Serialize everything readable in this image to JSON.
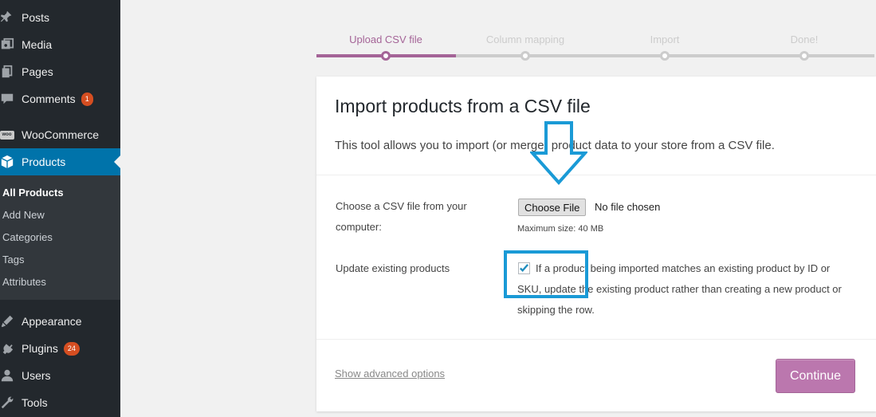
{
  "sidebar": {
    "items": [
      {
        "label": "Posts",
        "icon": "pin-icon"
      },
      {
        "label": "Media",
        "icon": "media-icon"
      },
      {
        "label": "Pages",
        "icon": "pages-icon"
      },
      {
        "label": "Comments",
        "icon": "comments-icon",
        "badge": "1"
      },
      {
        "label": "WooCommerce",
        "icon": "woocommerce-icon",
        "logo_text": "woo"
      },
      {
        "label": "Products",
        "icon": "products-icon"
      },
      {
        "label": "Appearance",
        "icon": "appearance-icon"
      },
      {
        "label": "Plugins",
        "icon": "plugins-icon",
        "badge": "24"
      },
      {
        "label": "Users",
        "icon": "users-icon"
      },
      {
        "label": "Tools",
        "icon": "tools-icon"
      }
    ],
    "submenu": [
      "All Products",
      "Add New",
      "Categories",
      "Tags",
      "Attributes"
    ],
    "active_item": "Products",
    "colors": {
      "background": "#23282d",
      "active": "#0073aa",
      "badge": "#d54e21"
    }
  },
  "steps": {
    "items": [
      "Upload CSV file",
      "Column mapping",
      "Import",
      "Done!"
    ],
    "active_index": 0,
    "colors": {
      "active": "#a46497",
      "inactive": "#cccccc"
    }
  },
  "card": {
    "title": "Import products from a CSV file",
    "description": "This tool allows you to import (or merge) product data to your store from a CSV file.",
    "file_label": "Choose a CSV file from your computer:",
    "choose_file_label": "Choose File",
    "file_status": "No file chosen",
    "max_size": "Maximum size: 40 MB",
    "update_label": "Update existing products",
    "update_checked": true,
    "update_description": "If a product being imported matches an existing product by ID or SKU, update the existing product rather than creating a new product or skipping the row.",
    "advanced_link": "Show advanced options",
    "continue_label": "Continue",
    "continue_color": "#bb77ae"
  },
  "annotations": {
    "color": "#1a9ad6"
  }
}
